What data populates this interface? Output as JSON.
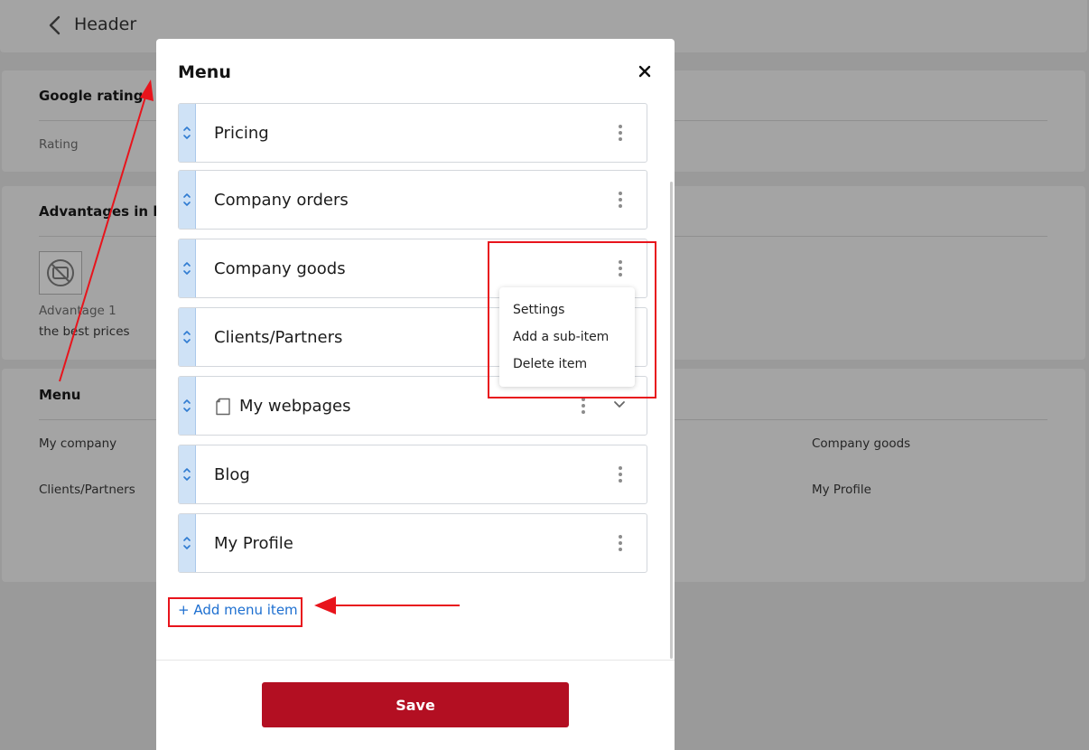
{
  "background": {
    "header_title": "Header",
    "google_rating": {
      "title": "Google rating",
      "label": "Rating"
    },
    "advantages": {
      "title": "Advantages in he",
      "item_title": "Advantage 1",
      "item_text": "the best prices"
    },
    "menu_section": {
      "title": "Menu",
      "cells": [
        "My company",
        "Company goods",
        "Clients/Partners",
        "My Profile"
      ]
    }
  },
  "modal": {
    "title": "Menu",
    "items": [
      {
        "label": "Pricing"
      },
      {
        "label": "Company orders"
      },
      {
        "label": "Company goods"
      },
      {
        "label": "Clients/Partners"
      },
      {
        "label": "My webpages"
      },
      {
        "label": "Blog"
      },
      {
        "label": "My Profile"
      }
    ],
    "dropdown": [
      "Settings",
      "Add a sub-item",
      "Delete item"
    ],
    "add_item_label": "+ Add menu item",
    "save_label": "Save"
  },
  "colors": {
    "accent_link": "#1d6fd0",
    "save_button": "#b30f22",
    "annotation": "#e8141c",
    "drag_handle": "#cfe2f6"
  }
}
